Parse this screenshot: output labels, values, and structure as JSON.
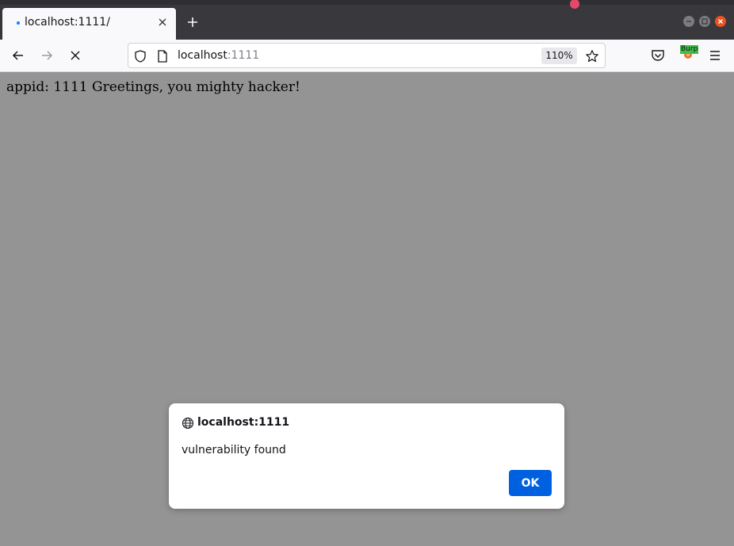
{
  "tab": {
    "title": "localhost:1111/"
  },
  "urlbar": {
    "host": "localhost",
    "port": ":1111",
    "zoom": "110%"
  },
  "page": {
    "text": "appid: 1111 Greetings, you mighty hacker!"
  },
  "extensions": {
    "burp_label": "Burp"
  },
  "dialog": {
    "origin": "localhost:1111",
    "message": "vulnerability found",
    "ok_label": "OK"
  },
  "colors": {
    "accent": "#0061e0",
    "overlay": "#949495",
    "tab_loading": "#0a84ff"
  },
  "icons": [
    "close-icon",
    "plus-icon",
    "back-arrow-icon",
    "forward-arrow-icon",
    "stop-icon",
    "shield-icon",
    "page-icon",
    "star-icon",
    "pocket-icon",
    "burp-icon",
    "hamburger-menu-icon",
    "globe-icon"
  ]
}
